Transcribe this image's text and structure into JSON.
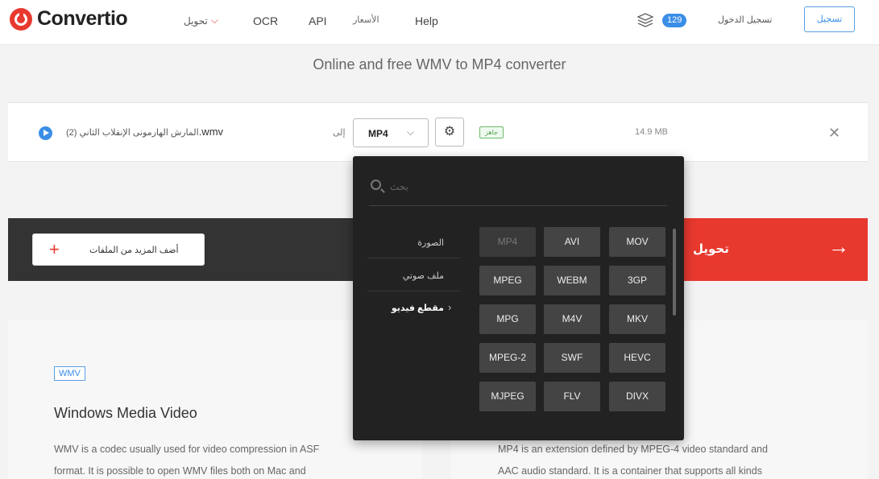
{
  "header": {
    "logo_text": "Convertio",
    "nav": {
      "convert": "تحويل",
      "ocr": "OCR",
      "api": "API",
      "pricing": "الأسعار",
      "help": "Help"
    },
    "credits": "129",
    "login": "تسجيل الدخول",
    "signup": "تسجيل"
  },
  "subtitle": "Online and free WMV to MP4 converter",
  "file_row": {
    "file_name_ar": "المارش الهارمونى الإنقلاب الثاني (2)",
    "file_name_ext": ".wmv",
    "to_label": "إلى",
    "selected_format": "MP4",
    "status": "جاهز",
    "size": "14.9 MB"
  },
  "dropdown": {
    "search_placeholder": "بحث",
    "categories": [
      "الصورة",
      "ملف صوتي",
      "مقطع فيديو"
    ],
    "formats": [
      "MP4",
      "AVI",
      "MOV",
      "MPEG",
      "WEBM",
      "3GP",
      "MPG",
      "M4V",
      "MKV",
      "MPEG-2",
      "SWF",
      "HEVC",
      "MJPEG",
      "FLV",
      "DIVX"
    ]
  },
  "actions": {
    "add_more": "أضف المزيد من الملفات",
    "convert": "تحويل"
  },
  "info": {
    "badge": "WMV",
    "title": "Windows Media Video",
    "left_text_1": "WMV is a codec usually used for video compression in ASF",
    "left_text_2": "format. It is possible to open WMV files both on Mac and",
    "right_text_1": "MP4 is an extension defined by MPEG-4 video standard and",
    "right_text_2": "AAC audio standard. It is a container that supports all kinds"
  },
  "colors": {
    "brand_red": "#e8392f",
    "accent_blue": "#3a8ee6",
    "dropdown_bg": "#222222"
  }
}
